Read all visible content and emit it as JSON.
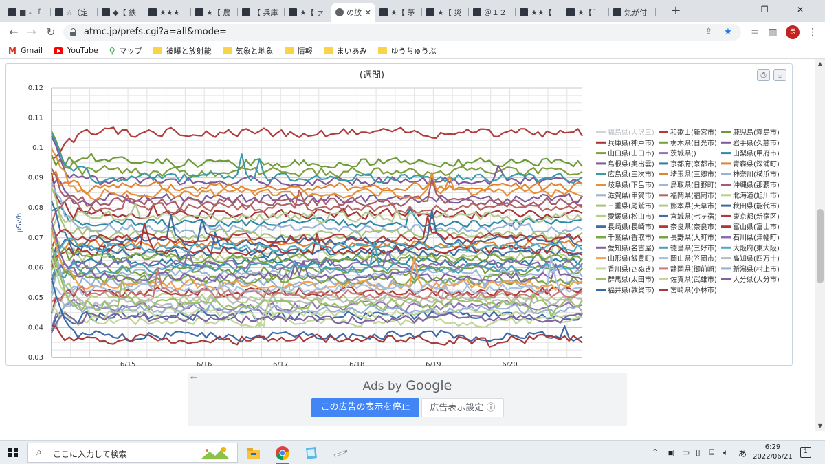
{
  "browser": {
    "tabs": [
      {
        "title": "■ - 「"
      },
      {
        "title": "☆（定"
      },
      {
        "title": "◆【 鉄"
      },
      {
        "title": "★★★"
      },
      {
        "title": "★【 農"
      },
      {
        "title": "【 兵庫"
      },
      {
        "title": "★【 ァ"
      },
      {
        "title": "の放",
        "active": true
      },
      {
        "title": "★【 茅"
      },
      {
        "title": "★【 災"
      },
      {
        "title": "＠１２"
      },
      {
        "title": "★★【"
      },
      {
        "title": "★【 ﾞ"
      },
      {
        "title": "気が付"
      }
    ],
    "new_tab": "+",
    "window_controls": {
      "minimize": "—",
      "maximize": "❐",
      "close": "✕"
    },
    "url": "atmc.jp/prefs.cgi?a=all&mode=",
    "profile_initial": "ま",
    "bookmarks": [
      {
        "label": "Gmail",
        "icon": "gmail-icon"
      },
      {
        "label": "YouTube",
        "icon": "youtube-icon"
      },
      {
        "label": "マップ",
        "icon": "maps-icon"
      },
      {
        "label": "被曝と放射能",
        "icon": "folder-icon"
      },
      {
        "label": "気象と地象",
        "icon": "folder-icon"
      },
      {
        "label": "情報",
        "icon": "folder-icon"
      },
      {
        "label": "まいあみ",
        "icon": "folder-icon"
      },
      {
        "label": "ゆうちゅうぶ",
        "icon": "folder-icon"
      }
    ]
  },
  "chart_data": {
    "type": "line",
    "title": "(週間)",
    "xlabel": "",
    "ylabel": "μSv/h",
    "ylim": [
      0.03,
      0.12
    ],
    "yticks": [
      "0.03",
      "0.04",
      "0.05",
      "0.06",
      "0.07",
      "0.08",
      "0.09",
      "0.1",
      "0.11",
      "0.12"
    ],
    "xticks": [
      "6/15",
      "6/16",
      "6/17",
      "6/18",
      "6/19",
      "6/20"
    ],
    "xlim_days": [
      14.0,
      20.95
    ],
    "legend_position": "right",
    "grid": true,
    "series": [
      {
        "name": "福島県(大沢三)",
        "color": "#c8cdd3",
        "base": 0.088,
        "disabled": true
      },
      {
        "name": "和歌山(新宮市)",
        "color": "#b23b3b",
        "base": 0.105
      },
      {
        "name": "鹿児島(霧島市)",
        "color": "#6e9b3a",
        "base": 0.095
      },
      {
        "name": "兵庫県(神戸市)",
        "color": "#a33636",
        "base": 0.078
      },
      {
        "name": "栃木県(日光市)",
        "color": "#7a9f3e",
        "base": 0.059
      },
      {
        "name": "岩手県(久慈市)",
        "color": "#7e5a9b",
        "base": 0.083
      },
      {
        "name": "山口県(山口市)",
        "color": "#7f9f3f",
        "base": 0.092
      },
      {
        "name": "茨城県()",
        "color": "#8e74b0",
        "base": 0.047
      },
      {
        "name": "山梨県(甲府市)",
        "color": "#2e88a6",
        "base": 0.075
      },
      {
        "name": "島根県(奥出雲)",
        "color": "#7e5a9b",
        "base": 0.089
      },
      {
        "name": "京都府(京都市)",
        "color": "#2d7fa0",
        "base": 0.062
      },
      {
        "name": "青森県(深浦町)",
        "color": "#e1832e",
        "base": 0.087
      },
      {
        "name": "広島県(三次市)",
        "color": "#3a9aa8",
        "base": 0.09
      },
      {
        "name": "埼玉県(三郷市)",
        "color": "#e1832e",
        "base": 0.068
      },
      {
        "name": "神奈川(横浜市)",
        "color": "#95b3d7",
        "base": 0.055
      },
      {
        "name": "岐阜県(下呂市)",
        "color": "#e69138",
        "base": 0.085
      },
      {
        "name": "鳥取県(日野町)",
        "color": "#9bb7d9",
        "base": 0.058
      },
      {
        "name": "沖縄県(那覇市)",
        "color": "#a65c6e",
        "base": 0.082
      },
      {
        "name": "滋賀県(甲賀市)",
        "color": "#95b3d7",
        "base": 0.073
      },
      {
        "name": "福岡県(福岡市)",
        "color": "#b36464",
        "base": 0.08
      },
      {
        "name": "北海道(旭川市)",
        "color": "#b8cf8c",
        "base": 0.064
      },
      {
        "name": "三重県(尾鷲市)",
        "color": "#a7c27b",
        "base": 0.071
      },
      {
        "name": "熊本県(天草市)",
        "color": "#b3c98d",
        "base": 0.077
      },
      {
        "name": "秋田県(能代市)",
        "color": "#3e6a9c",
        "base": 0.069
      },
      {
        "name": "愛媛県(松山市)",
        "color": "#b4cd8b",
        "base": 0.05
      },
      {
        "name": "宮城県(七ヶ宿)",
        "color": "#3d6fa5",
        "base": 0.044
      },
      {
        "name": "東京都(新宿区)",
        "color": "#b03a3a",
        "base": 0.052
      },
      {
        "name": "長崎県(長崎市)",
        "color": "#3a6ea5",
        "base": 0.065
      },
      {
        "name": "奈良県(奈良市)",
        "color": "#b03a3a",
        "base": 0.07
      },
      {
        "name": "富山県(富山市)",
        "color": "#a83838",
        "base": 0.066
      },
      {
        "name": "千葉県(香取市)",
        "color": "#7ea548",
        "base": 0.056
      },
      {
        "name": "長野県(大町市)",
        "color": "#7c9f45",
        "base": 0.063
      },
      {
        "name": "石川県(津幡町)",
        "color": "#8a6eb0",
        "base": 0.061
      },
      {
        "name": "愛知県(名古屋)",
        "color": "#8064a2",
        "base": 0.057
      },
      {
        "name": "徳島県(三好市)",
        "color": "#4aa0b5",
        "base": 0.06
      },
      {
        "name": "大阪府(東大阪)",
        "color": "#4bacc6",
        "base": 0.067
      },
      {
        "name": "山形県(飯豊町)",
        "color": "#f0a050",
        "base": 0.054
      },
      {
        "name": "岡山県(笠岡市)",
        "color": "#a5bfdf",
        "base": 0.053
      },
      {
        "name": "高知県(四万十)",
        "color": "#b8bcc2",
        "base": 0.049
      },
      {
        "name": "香川県(さぬき)",
        "color": "#c4d79b",
        "base": 0.045
      },
      {
        "name": "静岡県(御前崎)",
        "color": "#c77a7a",
        "base": 0.051
      },
      {
        "name": "新潟県(村上市)",
        "color": "#93b0d3",
        "base": 0.046
      },
      {
        "name": "群馬県(太田市)",
        "color": "#9cbf6a",
        "base": 0.048
      },
      {
        "name": "佐賀県(武雄市)",
        "color": "#c2d69a",
        "base": 0.042
      },
      {
        "name": "大分県(大分市)",
        "color": "#8064a2",
        "base": 0.043
      },
      {
        "name": "福井県(敦賀市)",
        "color": "#3b69a8",
        "base": 0.037
      },
      {
        "name": "宮崎県(小林市)",
        "color": "#a63a3a",
        "base": 0.036
      }
    ]
  },
  "chart_buttons": {
    "print_icon": "printer-icon",
    "download_icon": "download-icon"
  },
  "ad": {
    "back": "←",
    "ads_by": "Ads by",
    "google": "Google",
    "stop_label": "この広告の表示を停止",
    "settings_label": "広告表示設定 ⓘ"
  },
  "taskbar": {
    "search_placeholder": "ここに入力して検索",
    "time": "6:29",
    "date": "2022/06/21",
    "ime": "あ",
    "notification_count": "1"
  }
}
